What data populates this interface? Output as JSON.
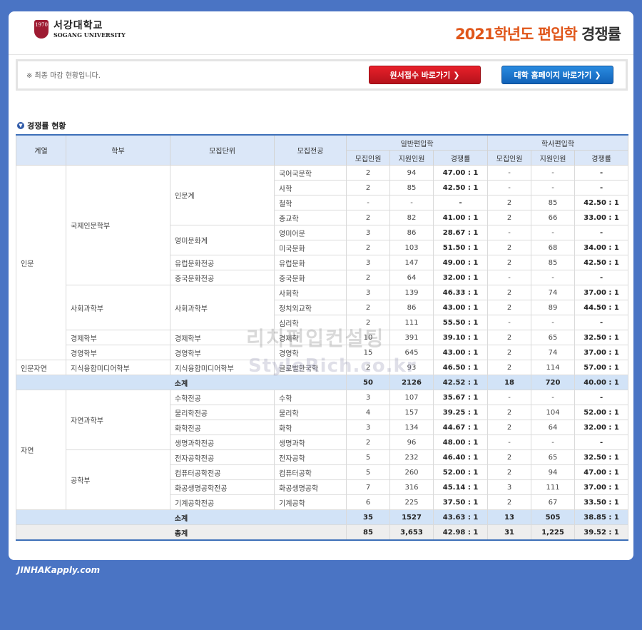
{
  "header": {
    "logo_mark": "1970",
    "logo_kr": "서강대학교",
    "logo_en": "SOGANG UNIVERSITY",
    "title_year": "2021학년도",
    "title_main": "편입학",
    "title_tail": "경쟁률"
  },
  "notice": {
    "text": "※ 최종 마감 현황입니다.",
    "apply_button": "원서접수 바로가기",
    "homepage_button": "대학 홈페이지 바로가기"
  },
  "section_title": "경쟁률 현황",
  "table": {
    "headers": {
      "category": "계열",
      "school": "학부",
      "unit": "모집단위",
      "major": "모집전공",
      "general": "일반편입학",
      "bachelor": "학사편입학",
      "quota": "모집인원",
      "applicants": "지원인원",
      "ratio": "경쟁률"
    },
    "groups": {
      "humanities": "인문",
      "hum_nat": "인문자연",
      "natural": "자연",
      "intl": "국제인문학부",
      "social": "사회과학부",
      "econ": "경제학부",
      "biz": "경영학부",
      "media": "지식융합미디어학부",
      "science": "자연과학부",
      "eng": "공학부",
      "u_hum": "인문계",
      "u_eng": "영미문화계",
      "u_eur": "유럽문화전공",
      "u_chn": "중국문화전공",
      "u_soc": "사회과학부",
      "u_econ": "경제학부",
      "u_biz": "경영학부",
      "u_media": "지식융합미디어학부"
    },
    "rows": [
      {
        "major": "국어국문학",
        "g_q": "2",
        "g_a": "94",
        "g_r": "47.00 : 1",
        "b_q": "-",
        "b_a": "-",
        "b_r": "-"
      },
      {
        "major": "사학",
        "g_q": "2",
        "g_a": "85",
        "g_r": "42.50 : 1",
        "b_q": "-",
        "b_a": "-",
        "b_r": "-"
      },
      {
        "major": "철학",
        "g_q": "-",
        "g_a": "-",
        "g_r": "-",
        "b_q": "2",
        "b_a": "85",
        "b_r": "42.50 : 1"
      },
      {
        "major": "종교학",
        "g_q": "2",
        "g_a": "82",
        "g_r": "41.00 : 1",
        "b_q": "2",
        "b_a": "66",
        "b_r": "33.00 : 1"
      },
      {
        "major": "영미어문",
        "g_q": "3",
        "g_a": "86",
        "g_r": "28.67 : 1",
        "b_q": "-",
        "b_a": "-",
        "b_r": "-"
      },
      {
        "major": "미국문화",
        "g_q": "2",
        "g_a": "103",
        "g_r": "51.50 : 1",
        "b_q": "2",
        "b_a": "68",
        "b_r": "34.00 : 1"
      },
      {
        "major": "유럽문화",
        "g_q": "3",
        "g_a": "147",
        "g_r": "49.00 : 1",
        "b_q": "2",
        "b_a": "85",
        "b_r": "42.50 : 1"
      },
      {
        "major": "중국문화",
        "g_q": "2",
        "g_a": "64",
        "g_r": "32.00 : 1",
        "b_q": "-",
        "b_a": "-",
        "b_r": "-"
      },
      {
        "major": "사회학",
        "g_q": "3",
        "g_a": "139",
        "g_r": "46.33 : 1",
        "b_q": "2",
        "b_a": "74",
        "b_r": "37.00 : 1"
      },
      {
        "major": "정치외교학",
        "g_q": "2",
        "g_a": "86",
        "g_r": "43.00 : 1",
        "b_q": "2",
        "b_a": "89",
        "b_r": "44.50 : 1"
      },
      {
        "major": "심리학",
        "g_q": "2",
        "g_a": "111",
        "g_r": "55.50 : 1",
        "b_q": "-",
        "b_a": "-",
        "b_r": "-"
      },
      {
        "major": "경제학",
        "g_q": "10",
        "g_a": "391",
        "g_r": "39.10 : 1",
        "b_q": "2",
        "b_a": "65",
        "b_r": "32.50 : 1"
      },
      {
        "major": "경영학",
        "g_q": "15",
        "g_a": "645",
        "g_r": "43.00 : 1",
        "b_q": "2",
        "b_a": "74",
        "b_r": "37.00 : 1"
      },
      {
        "major": "글로벌한국학",
        "g_q": "2",
        "g_a": "93",
        "g_r": "46.50 : 1",
        "b_q": "2",
        "b_a": "114",
        "b_r": "57.00 : 1"
      }
    ],
    "subtotal1": {
      "label": "소계",
      "g_q": "50",
      "g_a": "2126",
      "g_r": "42.52 : 1",
      "b_q": "18",
      "b_a": "720",
      "b_r": "40.00 : 1"
    },
    "rows2": [
      {
        "unit": "수학전공",
        "major": "수학",
        "g_q": "3",
        "g_a": "107",
        "g_r": "35.67 : 1",
        "b_q": "-",
        "b_a": "-",
        "b_r": "-"
      },
      {
        "unit": "물리학전공",
        "major": "물리학",
        "g_q": "4",
        "g_a": "157",
        "g_r": "39.25 : 1",
        "b_q": "2",
        "b_a": "104",
        "b_r": "52.00 : 1"
      },
      {
        "unit": "화학전공",
        "major": "화학",
        "g_q": "3",
        "g_a": "134",
        "g_r": "44.67 : 1",
        "b_q": "2",
        "b_a": "64",
        "b_r": "32.00 : 1"
      },
      {
        "unit": "생명과학전공",
        "major": "생명과학",
        "g_q": "2",
        "g_a": "96",
        "g_r": "48.00 : 1",
        "b_q": "-",
        "b_a": "-",
        "b_r": "-"
      },
      {
        "unit": "전자공학전공",
        "major": "전자공학",
        "g_q": "5",
        "g_a": "232",
        "g_r": "46.40 : 1",
        "b_q": "2",
        "b_a": "65",
        "b_r": "32.50 : 1"
      },
      {
        "unit": "컴퓨터공학전공",
        "major": "컴퓨터공학",
        "g_q": "5",
        "g_a": "260",
        "g_r": "52.00 : 1",
        "b_q": "2",
        "b_a": "94",
        "b_r": "47.00 : 1"
      },
      {
        "unit": "화공생명공학전공",
        "major": "화공생명공학",
        "g_q": "7",
        "g_a": "316",
        "g_r": "45.14 : 1",
        "b_q": "3",
        "b_a": "111",
        "b_r": "37.00 : 1"
      },
      {
        "unit": "기계공학전공",
        "major": "기계공학",
        "g_q": "6",
        "g_a": "225",
        "g_r": "37.50 : 1",
        "b_q": "2",
        "b_a": "67",
        "b_r": "33.50 : 1"
      }
    ],
    "subtotal2": {
      "label": "소계",
      "g_q": "35",
      "g_a": "1527",
      "g_r": "43.63 : 1",
      "b_q": "13",
      "b_a": "505",
      "b_r": "38.85 : 1"
    },
    "total": {
      "label": "총계",
      "g_q": "85",
      "g_a": "3,653",
      "g_r": "42.98 : 1",
      "b_q": "31",
      "b_a": "1,225",
      "b_r": "39.52 : 1"
    }
  },
  "watermark": {
    "line1": "리치편입컨설팅",
    "line2": "StyleRich.co.kr"
  },
  "footer": {
    "brand": "JINHAKapply.com"
  }
}
